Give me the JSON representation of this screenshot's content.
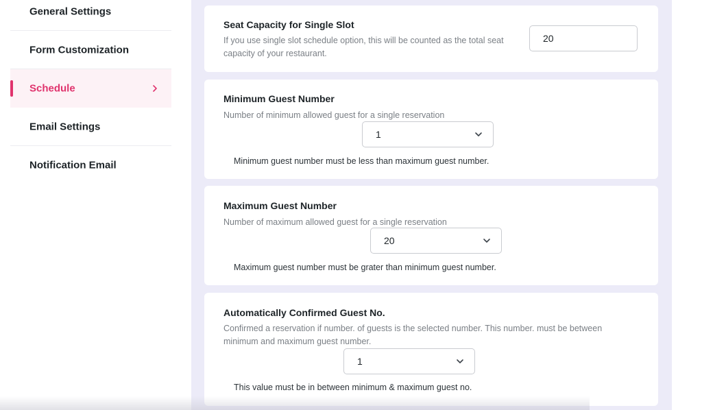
{
  "sidebar": {
    "items": [
      {
        "label": "General Settings",
        "active": false
      },
      {
        "label": "Form Customization",
        "active": false
      },
      {
        "label": "Schedule",
        "active": true
      },
      {
        "label": "Email Settings",
        "active": false
      },
      {
        "label": "Notification Email",
        "active": false
      }
    ]
  },
  "cards": {
    "seat_capacity": {
      "title": "Seat Capacity for Single Slot",
      "description": "If you use single slot schedule option, this will be counted as the total seat capacity of your restaurant.",
      "value": "20"
    },
    "min_guest": {
      "title": "Minimum Guest Number",
      "description": "Number of minimum allowed guest for a single reservation",
      "value": "1",
      "note": "Minimum guest number must be less than maximum guest number."
    },
    "max_guest": {
      "title": "Maximum Guest Number",
      "description": "Number of maximum allowed guest for a single reservation",
      "value": "20",
      "note": "Maximum guest number must be grater than minimum guest number."
    },
    "auto_confirm": {
      "title": "Automatically Confirmed Guest No.",
      "description": "Confirmed a reservation if number. of guests is the selected number. This number. must be between minimum and maximum guest number.",
      "value": "1",
      "note": "This value must be in between minimum & maximum guest no."
    }
  },
  "colors": {
    "accent": "#e0336d",
    "active_bg": "#fdf2f6",
    "main_bg": "#ecebf8"
  },
  "icons": {
    "nav_active": "chevron-right-icon",
    "select": "chevron-down-icon"
  }
}
